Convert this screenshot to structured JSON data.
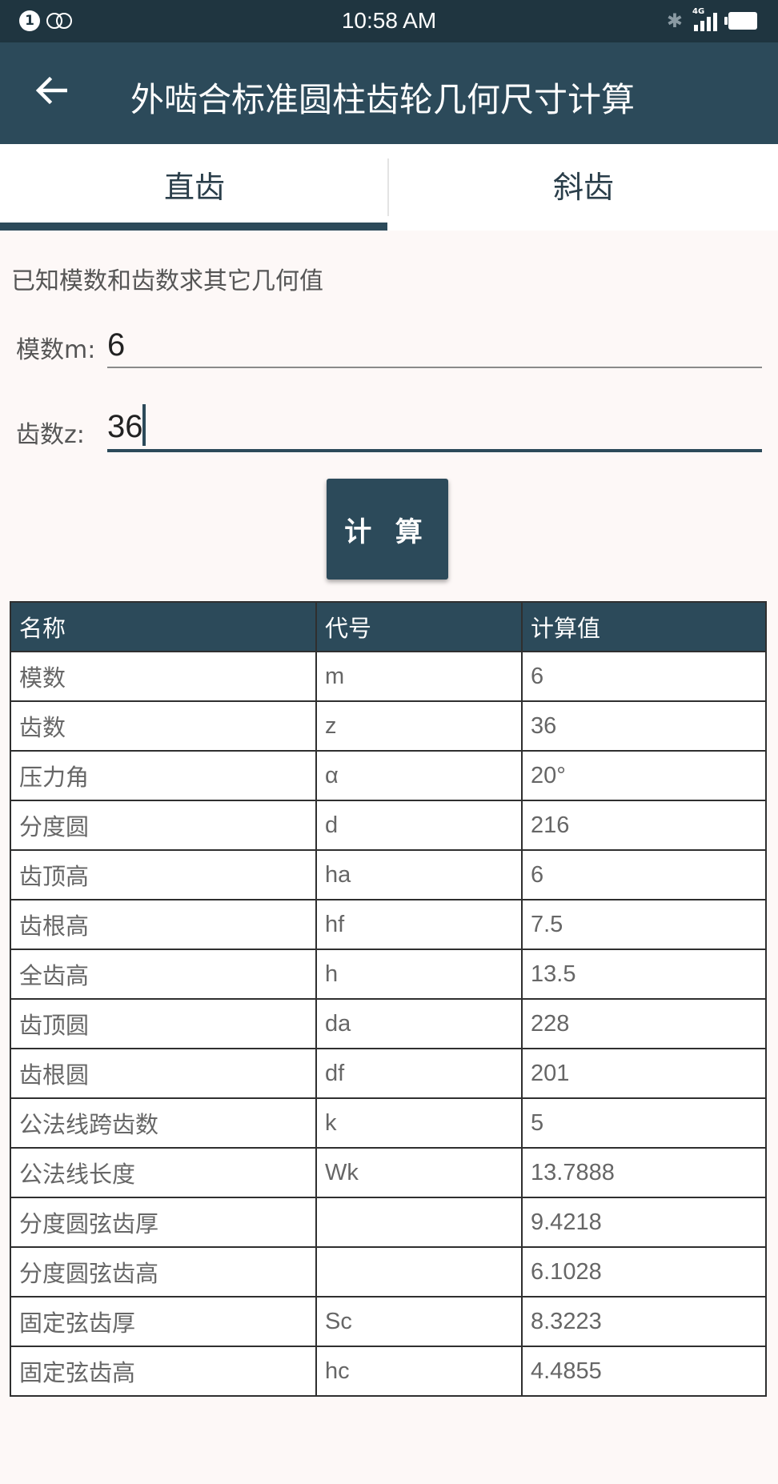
{
  "status_bar": {
    "time": "10:58 AM",
    "notification_count": "1",
    "network_label": "4G"
  },
  "app_bar": {
    "title": "外啮合标准圆柱齿轮几何尺寸计算"
  },
  "tabs": [
    {
      "label": "直齿",
      "selected": true
    },
    {
      "label": "斜齿",
      "selected": false
    }
  ],
  "form": {
    "hint": "已知模数和齿数求其它几何值",
    "modulus": {
      "label": "模数m:",
      "value": "6"
    },
    "teeth": {
      "label": "齿数z:",
      "value": "36"
    },
    "calc_button": "计 算"
  },
  "table": {
    "headers": [
      "名称",
      "代号",
      "计算值"
    ],
    "rows": [
      [
        "模数",
        "m",
        "6"
      ],
      [
        "齿数",
        "z",
        "36"
      ],
      [
        "压力角",
        "α",
        "20°"
      ],
      [
        "分度圆",
        "d",
        "216"
      ],
      [
        "齿顶高",
        "ha",
        "6"
      ],
      [
        "齿根高",
        "hf",
        "7.5"
      ],
      [
        "全齿高",
        "h",
        "13.5"
      ],
      [
        "齿顶圆",
        "da",
        "228"
      ],
      [
        "齿根圆",
        "df",
        "201"
      ],
      [
        "公法线跨齿数",
        "k",
        "5"
      ],
      [
        "公法线长度",
        "Wk",
        "13.7888"
      ],
      [
        "分度圆弦齿厚",
        "",
        "9.4218"
      ],
      [
        "分度圆弦齿高",
        "",
        "6.1028"
      ],
      [
        "固定弦齿厚",
        "Sc",
        "8.3223"
      ],
      [
        "固定弦齿高",
        "hc",
        "4.4855"
      ]
    ]
  },
  "colors": {
    "primary": "#2c4a5a",
    "status_bar": "#1f3540",
    "background": "#fdf8f7"
  }
}
